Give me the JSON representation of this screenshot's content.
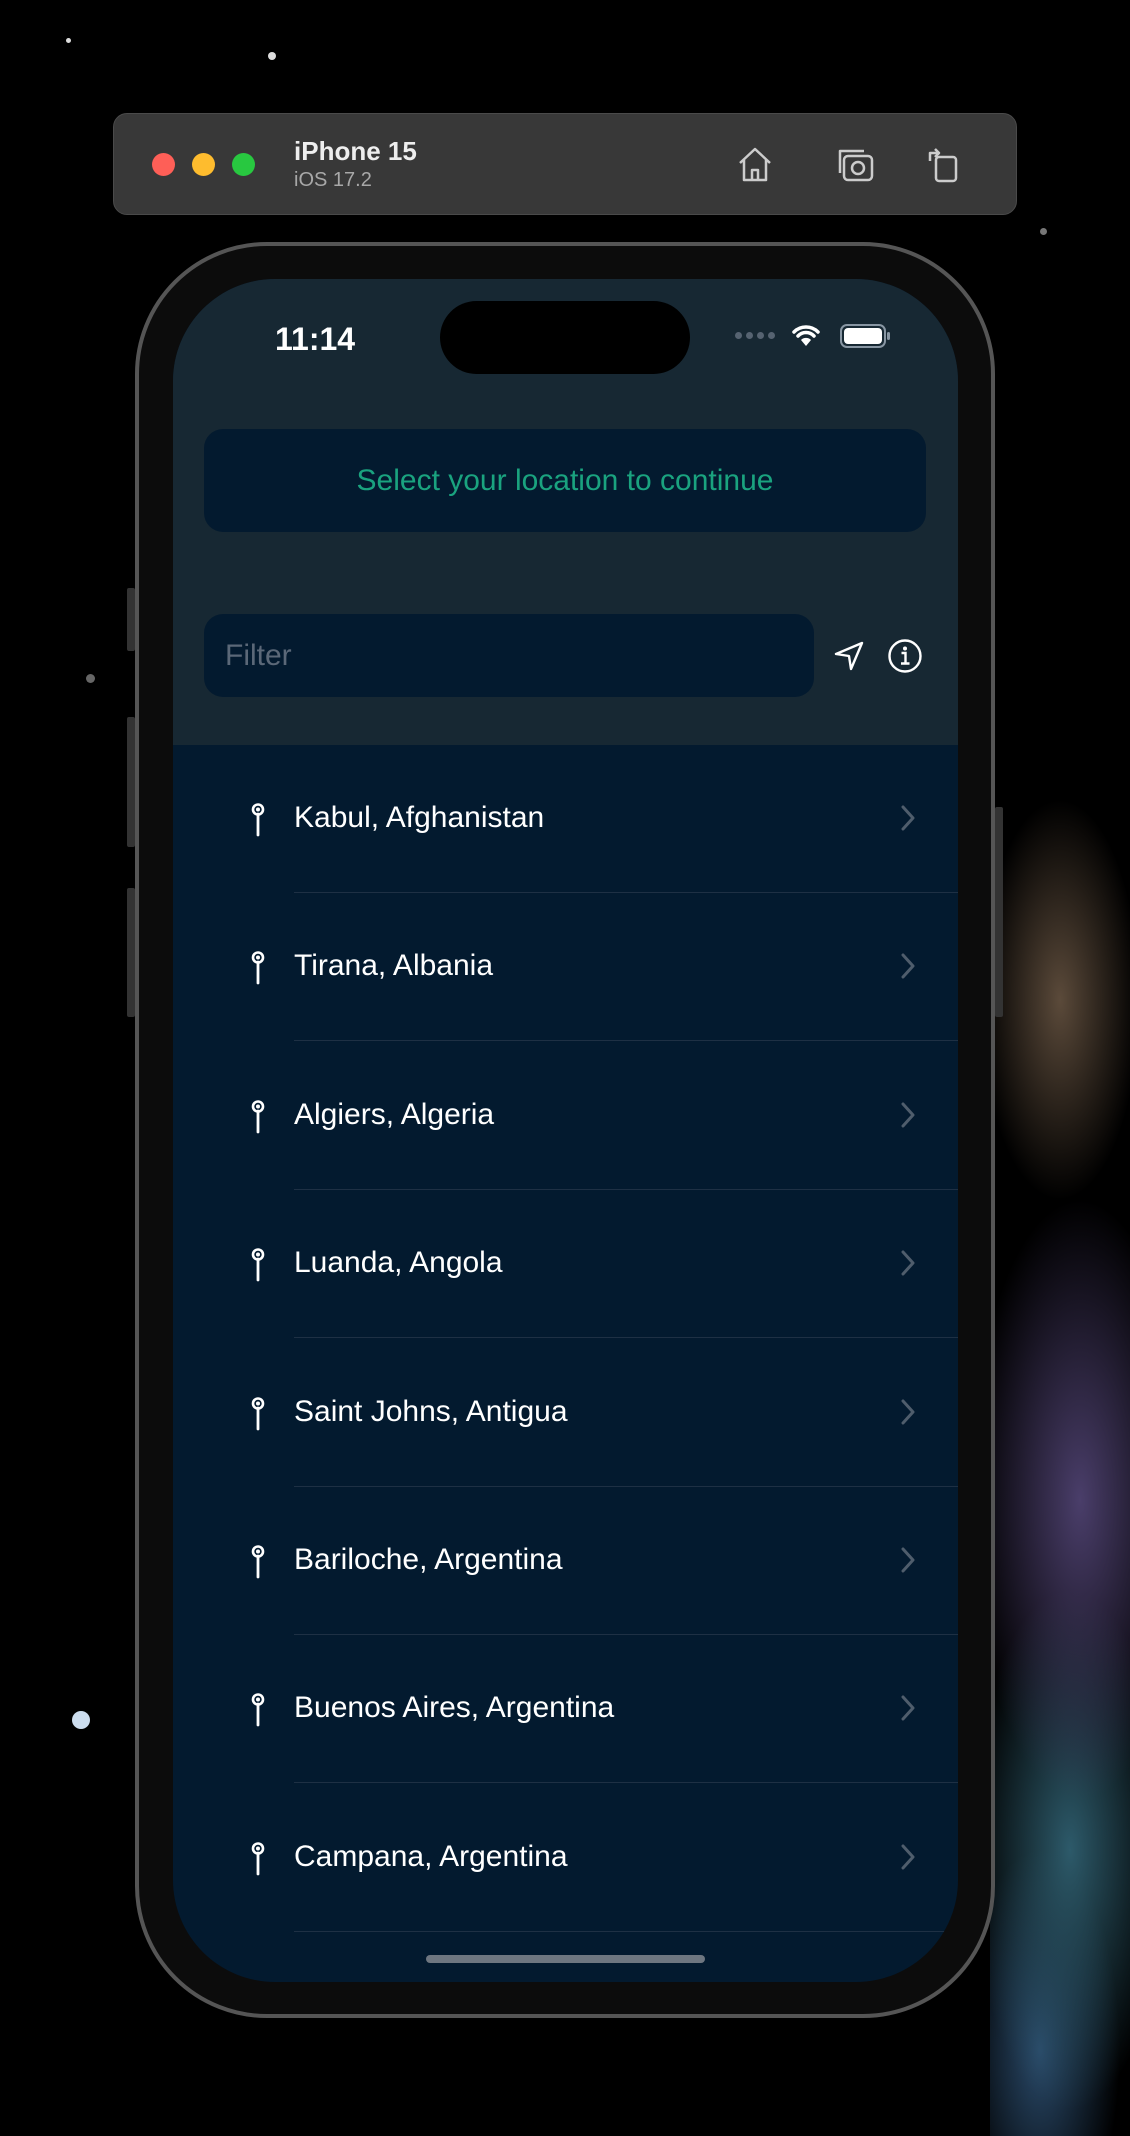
{
  "simulator": {
    "device_name": "iPhone 15",
    "os_version": "iOS 17.2",
    "toolbar_icons": [
      "home-icon",
      "screenshot-icon",
      "rotate-icon"
    ]
  },
  "status_bar": {
    "time": "11:14"
  },
  "banner": {
    "text": "Select your location to continue"
  },
  "filter": {
    "placeholder": "Filter",
    "value": ""
  },
  "locations": [
    {
      "label": "Kabul, Afghanistan"
    },
    {
      "label": "Tirana, Albania"
    },
    {
      "label": "Algiers, Algeria"
    },
    {
      "label": "Luanda, Angola"
    },
    {
      "label": "Saint Johns, Antigua"
    },
    {
      "label": "Bariloche, Argentina"
    },
    {
      "label": "Buenos Aires, Argentina"
    },
    {
      "label": "Campana, Argentina"
    }
  ],
  "colors": {
    "accent": "#1aa37f",
    "header_bg": "#172833",
    "list_bg": "#031a2f"
  }
}
